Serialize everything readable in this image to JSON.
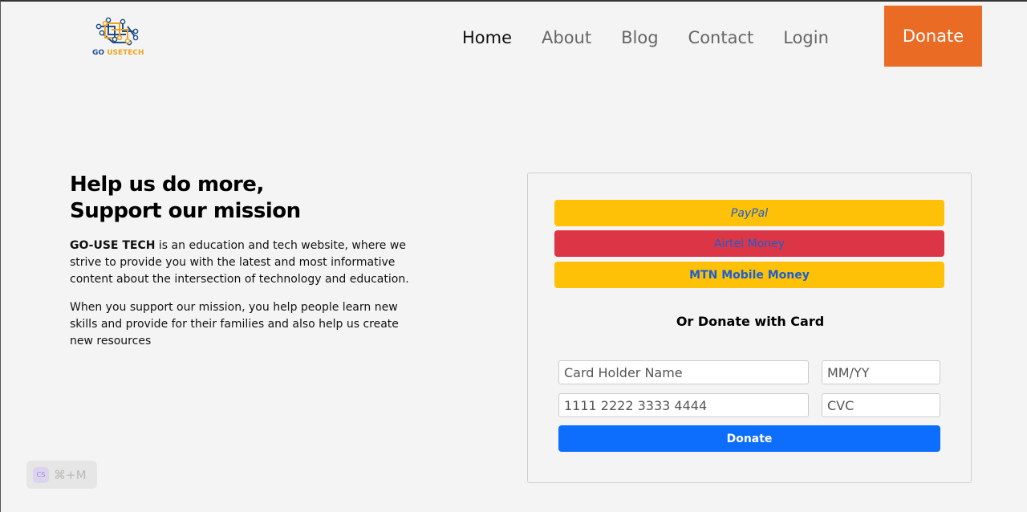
{
  "brand": {
    "logo_go": "GO",
    "logo_rest": "USETECH"
  },
  "nav": {
    "items": [
      {
        "label": "Home"
      },
      {
        "label": "About"
      },
      {
        "label": "Blog"
      },
      {
        "label": "Contact"
      },
      {
        "label": "Login"
      }
    ],
    "donate_label": "Donate"
  },
  "hero": {
    "title_line1": "Help us do more,",
    "title_line2": "Support our mission",
    "brand_name": "GO-USE TECH",
    "para1_rest": " is an education and tech website, where we strive to provide you with the latest and most informative content about the intersection of technology and education.",
    "para2": "When you support our mission, you help people learn new skills and provide for their families and also help us create new resources"
  },
  "donation": {
    "paypal_label": "PayPal",
    "airtel_label": "Airtel Money",
    "mtn_label": "MTN Mobile Money",
    "or_card_title": "Or Donate with Card",
    "card_holder_placeholder": "Card Holder Name",
    "expiry_placeholder": "MM/YY",
    "card_number_placeholder": "1111 2222 3333 4444",
    "cvc_placeholder": "CVC",
    "donate_label": "Donate"
  },
  "shortcut": {
    "badge": "CS",
    "keys": "⌘+M"
  },
  "colors": {
    "accent_orange": "#ea6b24",
    "paypal_yellow": "#ffc107",
    "airtel_red": "#dc3545",
    "primary_blue": "#0d6efd"
  }
}
